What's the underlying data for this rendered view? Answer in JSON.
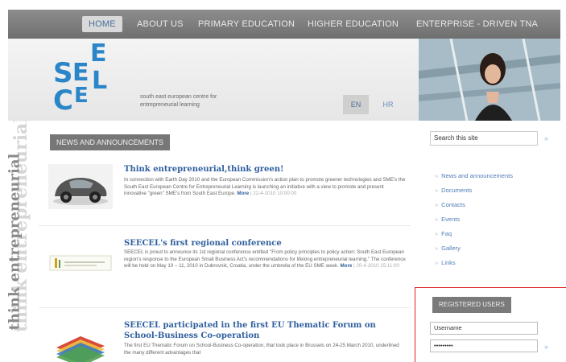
{
  "nav": {
    "items": [
      {
        "label": "HOME"
      },
      {
        "label": "ABOUT US"
      },
      {
        "label": "PRIMARY EDUCATION"
      },
      {
        "label": "HIGHER EDUCATION"
      },
      {
        "label": "ENTERPRISE - DRIVEN TNA"
      }
    ]
  },
  "header": {
    "logo_text": "SEECEL",
    "tagline": "south east european centre for entrepreneurial learning",
    "lang_en": "EN",
    "lang_hr": "HR"
  },
  "side_text": "think entrepreneurial",
  "main": {
    "section_title": "NEWS AND ANNOUNCEMENTS",
    "articles": [
      {
        "title": "Think entrepreneurial,think green!",
        "body": "In connection with Earth Day 2010 and the European Commission's action plan to promote greener technologies and SME's the South East European Centre for Entrepreneurial Learning is launching an initiative with a view to promote and present innovative \"green\" SME's from South East Europe.",
        "more": "More",
        "date": "| 22-4-2010 10:00:00"
      },
      {
        "title": "SEECEL's first regional conference",
        "body": "SEECEL is proud to announce its 1st regional conference entitled \"From policy principles to policy action: South East European region's response to the European Small Business Act's recommendations for lifelong entrepreneurial learning.\" The conference will be held on May 10 – 11, 2010 in Dubrovnik, Croatia, under the umbrella of the EU SME week.",
        "more": "More",
        "date": "| 20-4-2010 15:11:00"
      },
      {
        "title": "SEECEL participated in the first EU Thematic Forum on School-Business Co-operation",
        "body": "The first EU Thematic Forum on School-Business Co-operation, that took place in Brussels on 24-25 March 2010, underlined the many different advantages that"
      }
    ]
  },
  "sidebar": {
    "search_value": "Search this site",
    "search_go": "»",
    "links": [
      {
        "label": "News and announcements"
      },
      {
        "label": "Documents"
      },
      {
        "label": "Contacts"
      },
      {
        "label": "Events"
      },
      {
        "label": "Faq"
      },
      {
        "label": "Gallery"
      },
      {
        "label": "Links"
      }
    ],
    "registered_title": "REGISTERED USERS",
    "username_value": "Username",
    "password_value": "•••••••••",
    "login_go": "»"
  },
  "colors": {
    "nav_bg": "#777777",
    "link_blue": "#2f5f9e",
    "highlight_border": "#e02020"
  }
}
